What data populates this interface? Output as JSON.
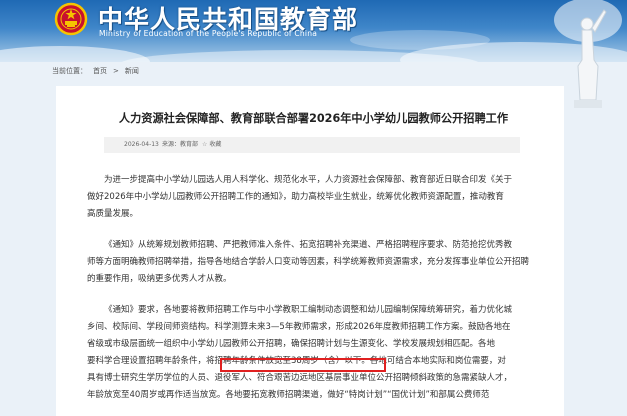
{
  "header": {
    "title_cn": "中华人民共和国教育部",
    "title_en": "Ministry of Education of the People's Republic of China"
  },
  "breadcrumb": {
    "prefix": "当前位置：",
    "home": "首页",
    "sep": ">",
    "current": "新闻"
  },
  "article": {
    "title": "人力资源社会保障部、教育部联合部署2026年中小学幼儿园教师公开招聘工作",
    "date": "2026-04-13",
    "source": "来源：教育部",
    "favorite": "收藏",
    "paragraphs": [
      [
        "为进一步提高中小学幼儿园选人用人科学化、规范化水平，人力资源社会保障部、教育部近日联合印发《关于",
        "做好2026年中小学幼儿园教师公开招聘工作的通知》，助力高校毕业生就业，统筹优化教师资源配置，推动教育",
        "高质量发展。"
      ],
      [
        "《通知》从统筹规划教师招聘、严把教师准入条件、拓宽招聘补充渠道、严格招聘程序要求、防范抢挖优秀教",
        "师等方面明确教师招聘举措，指导各地结合学龄人口变动等因素，科学统筹教师资源需求，充分发挥事业单位公开招聘",
        "的重要作用，吸纳更多优秀人才从教。"
      ],
      [
        "《通知》要求，各地要将教师招聘工作与中小学教职工编制动态调整和幼儿园编制保障统筹研究，着力优化城",
        "乡间、校际间、学段间师资结构。科学测算未来3—5年教师需求，形成2026年度教师招聘工作方案。鼓励各地在",
        "省级或市级层面统一组织中小学幼儿园教师公开招聘，确保招聘计划与生源变化、学校发展规划相匹配。各地",
        "要科学合理设置招聘年龄条件，将招聘年龄条件放宽至38周岁（含）以下。各地可结合本地实际和岗位需要，对",
        "具有博士研究生学历学位的人员、退役军人、符合艰苦边远地区基层事业单位公开招聘倾斜政策的急需紧缺人才，",
        "年龄放宽至40周岁或再作适当放宽。各地要拓宽教师招聘渠道，做好“特岗计划”“国优计划”和部属公费师范"
      ]
    ]
  }
}
